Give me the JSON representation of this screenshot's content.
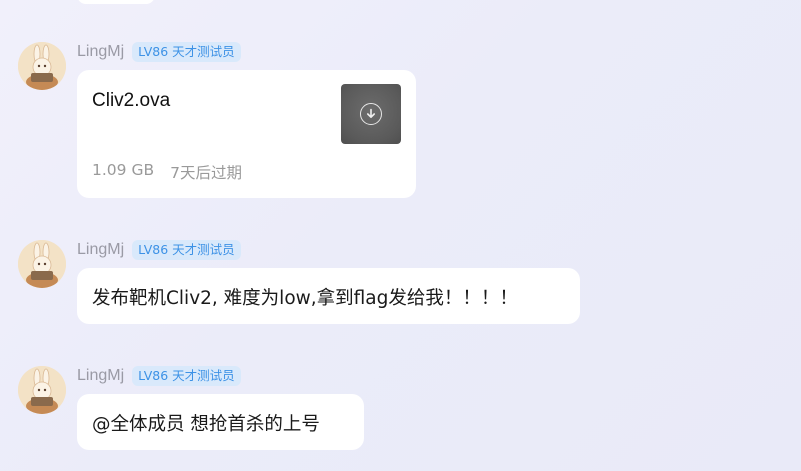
{
  "messages": [
    {
      "sender": "LingMj",
      "badge": "LV86 天才测试员",
      "type": "file",
      "file": {
        "name": "Cliv2.ova",
        "size": "1.09 GB",
        "expiry": "7天后过期",
        "action_icon": "download-icon"
      }
    },
    {
      "sender": "LingMj",
      "badge": "LV86 天才测试员",
      "type": "text",
      "text": "发布靶机Cliv2, 难度为low,拿到flag发给我！！！！"
    },
    {
      "sender": "LingMj",
      "badge": "LV86 天才测试员",
      "type": "text",
      "text": "@全体成员 想抢首杀的上号"
    }
  ],
  "colors": {
    "background": "#ecebf9",
    "bubble": "#ffffff",
    "badge_bg": "#d9e9fb",
    "badge_text": "#3d92e6",
    "sender_name": "#9a9aa5"
  }
}
